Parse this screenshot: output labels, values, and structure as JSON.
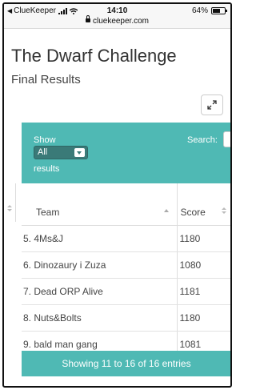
{
  "status_bar": {
    "back_app": "ClueKeeper",
    "time": "14:10",
    "url": "cluekeeper.com",
    "battery": "64%",
    "battery_level": 0.64
  },
  "page": {
    "title": "The Dwarf Challenge",
    "subtitle": "Final Results"
  },
  "controls": {
    "show_label": "Show",
    "results_label": "results",
    "page_size": "All",
    "search_label": "Search:",
    "search_value": ""
  },
  "table": {
    "columns": [
      "Team",
      "Score"
    ],
    "rows": [
      {
        "team": "5. 4Ms&J",
        "score": "1180"
      },
      {
        "team": "6. Dinozaury i Zuza",
        "score": "1080"
      },
      {
        "team": "7. Dead ORP Alive",
        "score": "1181"
      },
      {
        "team": "8. Nuts&Bolts",
        "score": "1180"
      },
      {
        "team": "9. bald man gang",
        "score": "1081"
      }
    ]
  },
  "footer": {
    "info": "Showing 11 to 16 of 16 entries"
  },
  "colors": {
    "accent": "#4fb9b4",
    "select_bg": "#3a7a78"
  },
  "icons": {
    "expand": "expand-arrows-icon",
    "lock": "lock-icon"
  }
}
